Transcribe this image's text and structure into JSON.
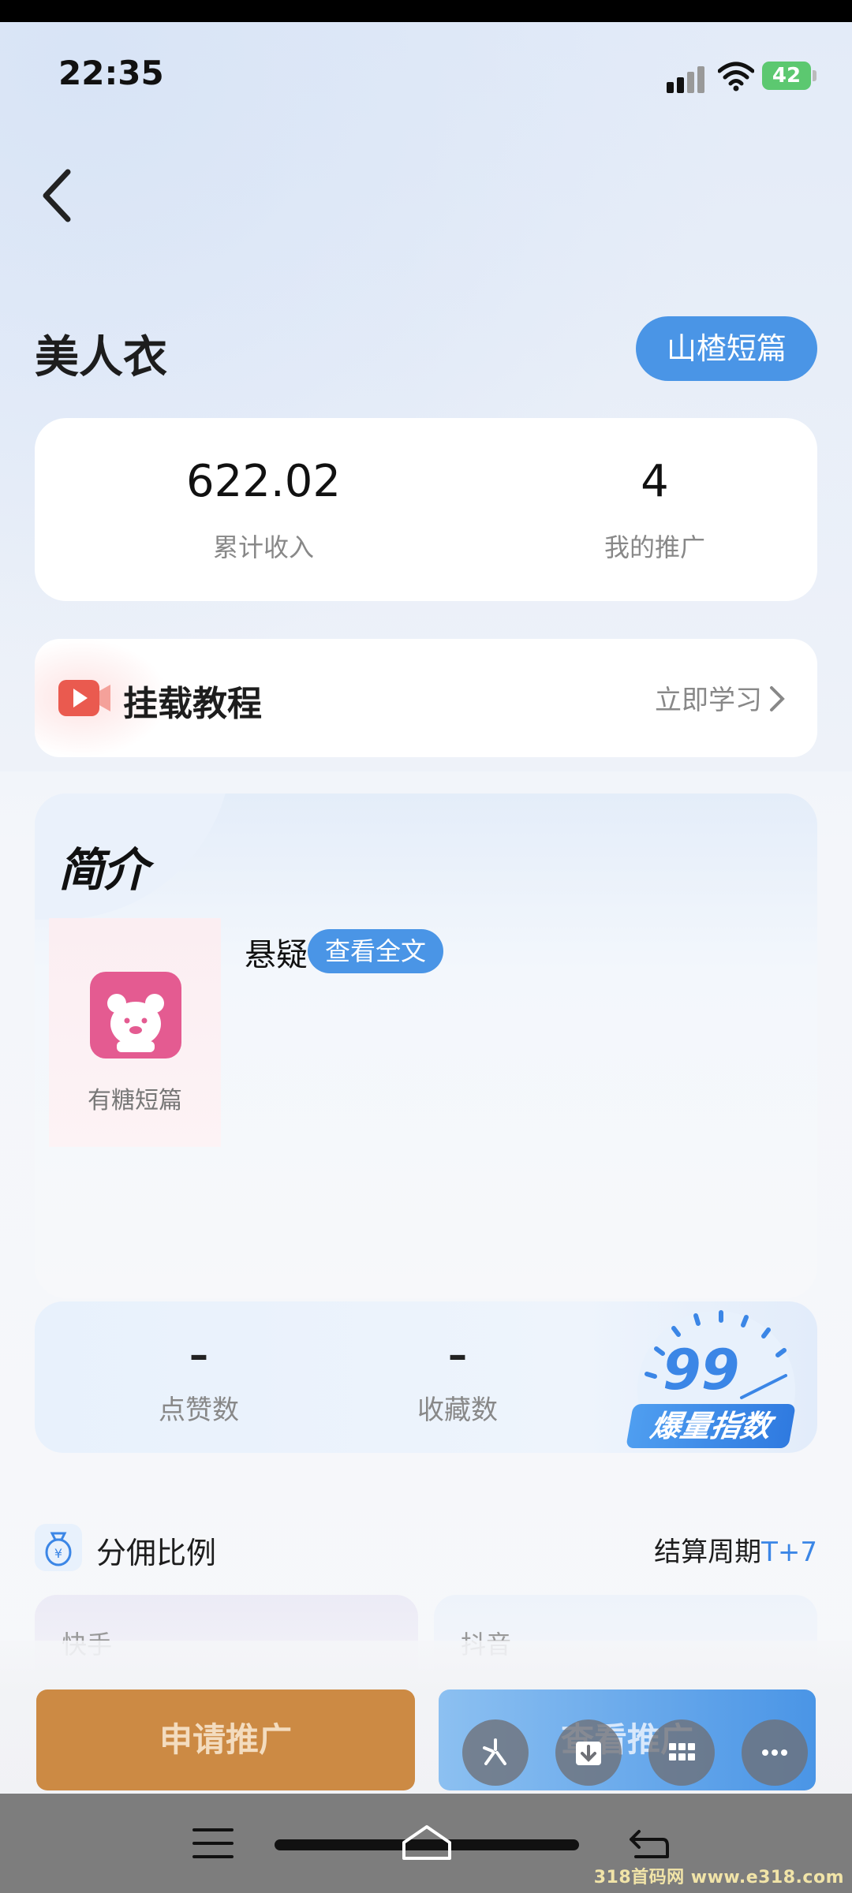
{
  "status_bar": {
    "time": "22:35",
    "battery": "42"
  },
  "page": {
    "title": "美人衣",
    "source_tag": "山楂短篇"
  },
  "stats": [
    {
      "value": "622.02",
      "label": "累计收入"
    },
    {
      "value": "4",
      "label": "我的推广"
    }
  ],
  "tutorial": {
    "label": "挂载教程",
    "action": "立即学习"
  },
  "intro": {
    "title": "简介",
    "cover_name": "有糖短篇",
    "genre": "悬疑",
    "full_text_button": "查看全文"
  },
  "metrics": {
    "likes": {
      "value": "–",
      "label": "点赞数"
    },
    "favorites": {
      "value": "–",
      "label": "收藏数"
    },
    "hot_index": {
      "value": "99",
      "label": "爆量指数"
    }
  },
  "commission": {
    "label": "分佣比例",
    "cycle_label": "结算周期",
    "cycle_value": "T+7"
  },
  "platforms": [
    "快手",
    "抖音"
  ],
  "actions": {
    "apply": "申请推广",
    "view": "查看推广"
  },
  "watermark": "318首码网 www.e318.com",
  "colors": {
    "accent": "#4a95e6",
    "apply": "#cc8a44",
    "battery": "#5cc870"
  }
}
